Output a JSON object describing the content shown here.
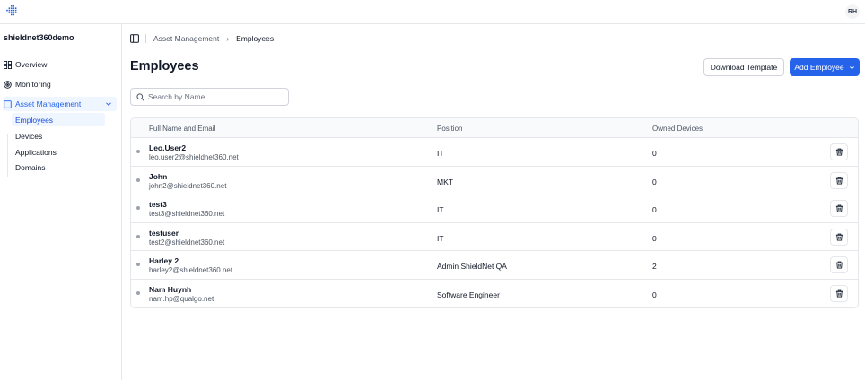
{
  "topbar": {
    "avatar_initials": "RH"
  },
  "sidebar": {
    "org_name": "shieldnet360demo",
    "items": [
      {
        "label": "Overview",
        "icon": "grid-icon"
      },
      {
        "label": "Monitoring",
        "icon": "radar-icon"
      },
      {
        "label": "Asset Management",
        "icon": "square-icon",
        "expanded": true
      }
    ],
    "sub_items": [
      {
        "label": "Employees",
        "active": true
      },
      {
        "label": "Devices"
      },
      {
        "label": "Applications"
      },
      {
        "label": "Domains"
      }
    ]
  },
  "breadcrumb": {
    "parent": "Asset Management",
    "current": "Employees"
  },
  "page": {
    "title": "Employees",
    "download_label": "Download Template",
    "add_label": "Add Employee"
  },
  "search": {
    "placeholder": "Search by Name"
  },
  "table": {
    "headers": [
      "Full Name and Email",
      "Position",
      "Owned Devices"
    ],
    "rows": [
      {
        "name": "Leo.User2",
        "email": "leo.user2@shieldnet360.net",
        "position": "IT",
        "devices": "0"
      },
      {
        "name": "John",
        "email": "john2@shieldnet360.net",
        "position": "MKT",
        "devices": "0"
      },
      {
        "name": "test3",
        "email": "test3@shieldnet360.net",
        "position": "IT",
        "devices": "0"
      },
      {
        "name": "testuser",
        "email": "test2@shieldnet360.net",
        "position": "IT",
        "devices": "0"
      },
      {
        "name": "Harley 2",
        "email": "harley2@shieldnet360.net",
        "position": "Admin ShieldNet QA",
        "devices": "2"
      },
      {
        "name": "Nam Huynh",
        "email": "nam.hp@qualgo.net",
        "position": "Software Engineer",
        "devices": "0"
      }
    ]
  },
  "colors": {
    "accent": "#2563eb",
    "active_bg": "#eff6ff",
    "border": "#e5e7eb"
  }
}
